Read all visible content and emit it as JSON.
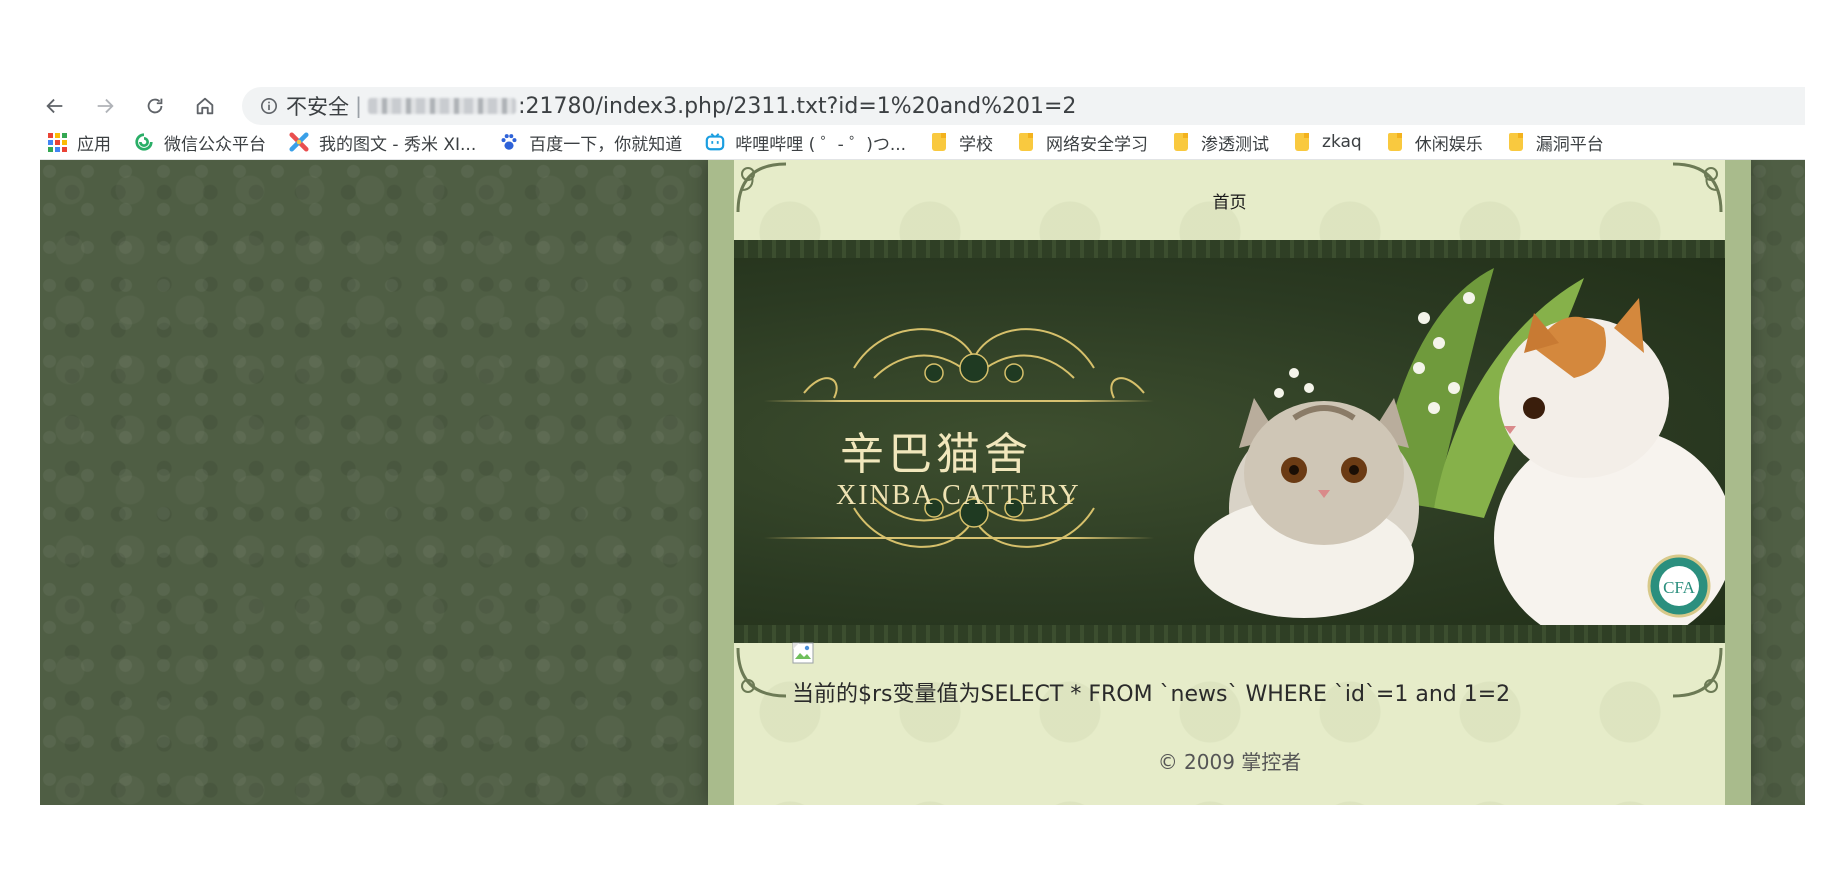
{
  "browser": {
    "nav": {
      "back_icon": "arrow-left-icon",
      "forward_icon": "arrow-right-icon",
      "reload_icon": "reload-icon",
      "home_icon": "home-icon"
    },
    "address_bar": {
      "security_label": "不安全",
      "separator": "|",
      "url_suffix": ":21780/index3.php/2311.txt?id=1%20and%201=2"
    },
    "bookmarks": [
      {
        "label": "应用",
        "icon": "apps-grid-icon"
      },
      {
        "label": "微信公众平台",
        "icon": "wechat-icon",
        "color": "#2aae67"
      },
      {
        "label": "我的图文 - 秀米 XI...",
        "icon": "xiumi-icon",
        "color": "#e94f4f"
      },
      {
        "label": "百度一下，你就知道",
        "icon": "baidu-paw-icon",
        "color": "#2e62d8"
      },
      {
        "label": "哔哩哔哩 ( ゜- ゜)つ...",
        "icon": "bilibili-icon",
        "color": "#1b9ee0"
      },
      {
        "label": "学校",
        "icon": "folder-icon"
      },
      {
        "label": "网络安全学习",
        "icon": "folder-icon"
      },
      {
        "label": "渗透测试",
        "icon": "folder-icon"
      },
      {
        "label": "zkaq",
        "icon": "folder-icon"
      },
      {
        "label": "休闲娱乐",
        "icon": "folder-icon"
      },
      {
        "label": "漏洞平台",
        "icon": "folder-icon"
      }
    ]
  },
  "site": {
    "nav_home": "首页",
    "banner": {
      "title_cn": "辛巴猫舍",
      "title_en": "XINBA CATTERY",
      "badge_text": "CFA"
    },
    "sql_message": "当前的$rs变量值为SELECT * FROM `news` WHERE `id`=1 and 1=2",
    "copyright": "© 2009 掌控者"
  },
  "colors": {
    "background_green": "#4f5e44",
    "content_cream": "#e6ecc9",
    "frame_green": "#a9bb8c",
    "folder_yellow": "#f9c93f"
  }
}
